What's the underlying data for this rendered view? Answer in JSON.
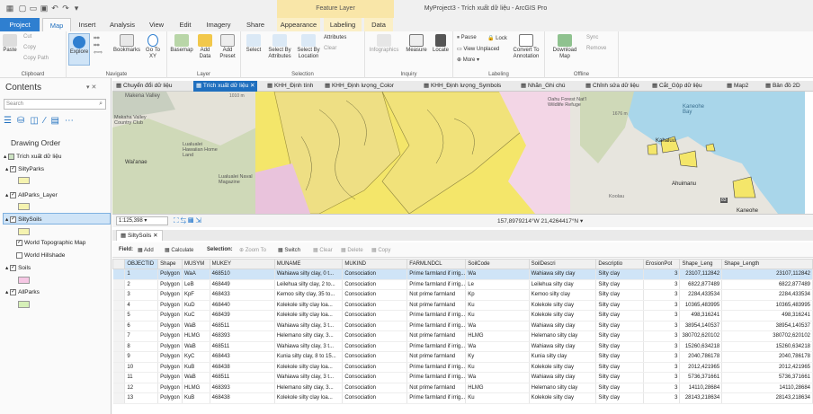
{
  "app": {
    "context_label": "Feature Layer",
    "window_title": "MyProject3 - Trích xuất dữ liệu - ArcGIS Pro"
  },
  "ribbon_tabs": [
    "Project",
    "Map",
    "Insert",
    "Analysis",
    "View",
    "Edit",
    "Imagery",
    "Share",
    "Appearance",
    "Labeling",
    "Data"
  ],
  "ribbon": {
    "clipboard": {
      "label": "Clipboard",
      "paste": "Paste",
      "cut": "Cut",
      "copy": "Copy",
      "copy_path": "Copy Path"
    },
    "navigate": {
      "label": "Navigate",
      "explore": "Explore",
      "bookmarks": "Bookmarks",
      "goto": "Go To XY"
    },
    "layer": {
      "label": "Layer",
      "basemap": "Basemap",
      "add_data": "Add Data",
      "add_preset": "Add Preset"
    },
    "selection": {
      "label": "Selection",
      "select": "Select",
      "by_attr": "Select By Attributes",
      "by_loc": "Select By Location",
      "attributes": "Attributes",
      "clear": "Clear"
    },
    "inquiry": {
      "label": "Inquiry",
      "infographics": "Infographics",
      "measure": "Measure",
      "locate": "Locate"
    },
    "labeling": {
      "label": "Labeling",
      "pause": "Pause",
      "lock": "Lock",
      "view_unplaced": "View Unplaced",
      "more": "More",
      "convert": "Convert To Annotation"
    },
    "offline": {
      "label": "Offline",
      "download": "Download Map",
      "sync": "Sync",
      "remove": "Remove"
    }
  },
  "contents": {
    "title": "Contents",
    "search_placeholder": "Search",
    "drawing_order": "Drawing Order",
    "map_name": "Trích xuất dữ liệu",
    "layers": [
      {
        "name": "SiltyParks",
        "checked": true,
        "color": "#f5f3b0"
      },
      {
        "name": "AllParks_Layer",
        "checked": true,
        "color": "#f5f3b0"
      },
      {
        "name": "SiltySoils",
        "checked": true,
        "color": "#f5f3b0"
      },
      {
        "name": "World Topographic Map",
        "checked": true
      },
      {
        "name": "World Hillshade",
        "checked": false
      },
      {
        "name": "Soils",
        "checked": true,
        "color": "#f6c7e4"
      },
      {
        "name": "AllParks",
        "checked": true,
        "color": "#d6f0b8"
      }
    ]
  },
  "map_tabs": [
    "Chuyển đổi dữ liệu",
    "Trích xuất dữ liệu",
    "KHH_Định tính",
    "KHH_Định lượng_Color",
    "KHH_Định lượng_Symbols",
    "Nhãn_Ghi chú",
    "Chỉnh sửa dữ liệu",
    "Cắt_Gộp dữ liệu",
    "Map2",
    "Bản đồ 2D"
  ],
  "map": {
    "scale": "1:125,398",
    "coords": "157,8979214°W 21,4264417°N",
    "labels": [
      "Makena Valley",
      "Makaha Valley Country Club",
      "Lualualei Hawaiian Home Land",
      "Wai'anae",
      "Lualualei Naval Magazine",
      "1010 m",
      "Oahu Forest Nat'l Wildlife Refuge",
      "Kaneohe Bay",
      "Kahaluu",
      "Ahuimanu",
      "Koolau",
      "Kaneohe",
      "1676 m",
      "83"
    ]
  },
  "table": {
    "tab_label": "SiltySoils",
    "field_label": "Field:",
    "add": "Add",
    "calculate": "Calculate",
    "selection_label": "Selection:",
    "zoom_to": "Zoom To",
    "switch": "Switch",
    "clear": "Clear",
    "delete": "Delete",
    "copy": "Copy",
    "columns": [
      "OBJECTID",
      "Shape",
      "MUSYM",
      "MUKEY",
      "MUNAME",
      "MUKIND",
      "FARMLNDCL",
      "SoilCode",
      "SoilDescri",
      "Descriptio",
      "ErosionPot",
      "Shape_Leng",
      "Shape_Length"
    ],
    "rows": [
      [
        "1",
        "Polygon",
        "WaA",
        "468510",
        "Wahiawa silty clay, 0 t...",
        "Consociation",
        "Prime farmland if irrig...",
        "Wa",
        "Wahiawa silty clay",
        "Silty clay",
        "3",
        "23107,112842",
        "23107,112842"
      ],
      [
        "2",
        "Polygon",
        "LeB",
        "468449",
        "Leilehua silty clay, 2 to...",
        "Consociation",
        "Prime farmland if irrig...",
        "Le",
        "Leilehua silty clay",
        "Silty clay",
        "3",
        "6822,877489",
        "6822,877489"
      ],
      [
        "3",
        "Polygon",
        "KpF",
        "468433",
        "Kemoo silty clay, 35 to...",
        "Consociation",
        "Not prime farmland",
        "Kp",
        "Kemoo silty clay",
        "Silty clay",
        "3",
        "2284,433534",
        "2284,433534"
      ],
      [
        "4",
        "Polygon",
        "KuD",
        "468440",
        "Kolekole silty clay loa...",
        "Consociation",
        "Not prime farmland",
        "Ku",
        "Kolekole silty clay",
        "Silty clay",
        "3",
        "10365,483995",
        "10365,483995"
      ],
      [
        "5",
        "Polygon",
        "KuC",
        "468439",
        "Kolekole silty clay loa...",
        "Consociation",
        "Prime farmland if irrig...",
        "Ku",
        "Kolekole silty clay",
        "Silty clay",
        "3",
        "498,316241",
        "498,316241"
      ],
      [
        "6",
        "Polygon",
        "WaB",
        "468511",
        "Wahiawa silty clay, 3 t...",
        "Consociation",
        "Prime farmland if irrig...",
        "Wa",
        "Wahiawa silty clay",
        "Silty clay",
        "3",
        "38954,140537",
        "38954,140537"
      ],
      [
        "7",
        "Polygon",
        "HLMG",
        "468393",
        "Helemano silty clay, 3...",
        "Consociation",
        "Not prime farmland",
        "HLMG",
        "Helemano silty clay",
        "Silty clay",
        "3",
        "380702,620102",
        "380702,620102"
      ],
      [
        "8",
        "Polygon",
        "WaB",
        "468511",
        "Wahiawa silty clay, 3 t...",
        "Consociation",
        "Prime farmland if irrig...",
        "Wa",
        "Wahiawa silty clay",
        "Silty clay",
        "3",
        "15260,634218",
        "15260,634218"
      ],
      [
        "9",
        "Polygon",
        "KyC",
        "468443",
        "Kunia silty clay, 8 to 15...",
        "Consociation",
        "Not prime farmland",
        "Ky",
        "Kunia silty clay",
        "Silty clay",
        "3",
        "2040,786178",
        "2040,786178"
      ],
      [
        "10",
        "Polygon",
        "KuB",
        "468438",
        "Kolekole silty clay loa...",
        "Consociation",
        "Prime farmland if irrig...",
        "Ku",
        "Kolekole silty clay",
        "Silty clay",
        "3",
        "2012,421965",
        "2012,421965"
      ],
      [
        "11",
        "Polygon",
        "WaB",
        "468511",
        "Wahiawa silty clay, 3 t...",
        "Consociation",
        "Prime farmland if irrig...",
        "Wa",
        "Wahiawa silty clay",
        "Silty clay",
        "3",
        "5736,371661",
        "5736,371661"
      ],
      [
        "12",
        "Polygon",
        "HLMG",
        "468393",
        "Helemano silty clay, 3...",
        "Consociation",
        "Not prime farmland",
        "HLMG",
        "Helemano silty clay",
        "Silty clay",
        "3",
        "14110,28684",
        "14110,28684"
      ],
      [
        "13",
        "Polygon",
        "KuB",
        "468438",
        "Kolekole silty clay loa...",
        "Consociation",
        "Prime farmland if irrig...",
        "Ku",
        "Kolekole silty clay",
        "Silty clay",
        "3",
        "28143,218634",
        "28143,218634"
      ]
    ]
  },
  "colors": {
    "accent": "#2f7fd0",
    "selected_tab": "#1f6fbf",
    "ribbon_bg": "#fafafa",
    "context": "#f9e6a8"
  }
}
